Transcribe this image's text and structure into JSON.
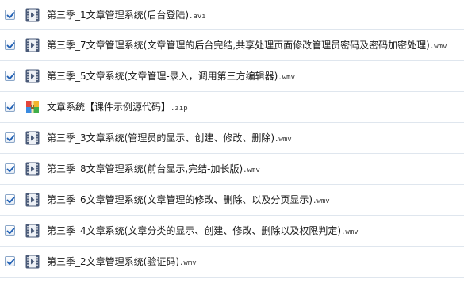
{
  "files": [
    {
      "name": "第三季_1文章管理系统(后台登陆)",
      "ext": ".avi",
      "icon": "video-file-icon",
      "checked": true
    },
    {
      "name": "第三季_7文章管理系统(文章管理的后台完结,共享处理页面修改管理员密码及密码加密处理)",
      "ext": ".wmv",
      "icon": "video-file-icon",
      "checked": true
    },
    {
      "name": "第三季_5文章系统(文章管理-录入，调用第三方编辑器)",
      "ext": ".wmv",
      "icon": "video-file-icon",
      "checked": true
    },
    {
      "name": "文章系统【课件示例源代码】",
      "ext": ".zip",
      "icon": "archive-file-icon",
      "checked": true
    },
    {
      "name": "第三季_3文章系统(管理员的显示、创建、修改、删除)",
      "ext": ".wmv",
      "icon": "video-file-icon",
      "checked": true
    },
    {
      "name": "第三季_8文章管理系统(前台显示,完结-加长版)",
      "ext": ".wmv",
      "icon": "video-file-icon",
      "checked": true
    },
    {
      "name": "第三季_6文章管理系统(文章管理的修改、删除、以及分页显示)",
      "ext": ".wmv",
      "icon": "video-file-icon",
      "checked": true
    },
    {
      "name": "第三季_4文章系统(文章分类的显示、创建、修改、删除以及权限判定)",
      "ext": ".wmv",
      "icon": "video-file-icon",
      "checked": true
    },
    {
      "name": "第三季_2文章管理系统(验证码)",
      "ext": ".wmv",
      "icon": "video-file-icon",
      "checked": true
    }
  ],
  "colors": {
    "check": "#1f5fb4",
    "video_icon": "#4a5a78",
    "row_border": "#dfe6ee"
  }
}
